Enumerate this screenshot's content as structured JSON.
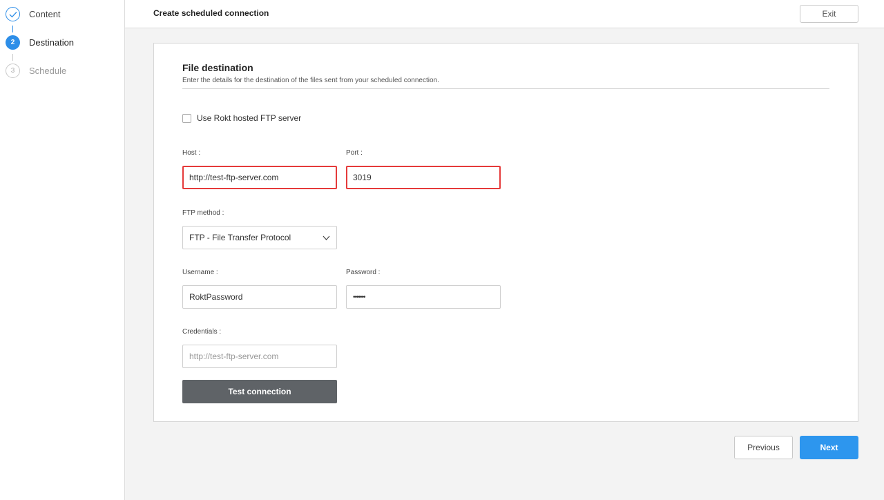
{
  "sidebar": {
    "steps": [
      {
        "label": "Content",
        "marker": "",
        "state": "completed",
        "icon": "check-icon"
      },
      {
        "label": "Destination",
        "marker": "2",
        "state": "active"
      },
      {
        "label": "Schedule",
        "marker": "3",
        "state": "upcoming"
      }
    ]
  },
  "header": {
    "title": "Create scheduled connection",
    "exit_label": "Exit"
  },
  "form": {
    "title": "File destination",
    "description": "Enter the details for the destination of the files sent from your scheduled connection.",
    "use_hosted_label": "Use Rokt hosted FTP server",
    "use_hosted_checked": false,
    "host": {
      "label": "Host",
      "value": "http://test-ftp-server.com",
      "error": true
    },
    "port": {
      "label": "Port",
      "value": "3019",
      "error": true
    },
    "ftp_method": {
      "label": "FTP method",
      "value": "FTP - File Transfer Protocol",
      "icon": "chevron-down-icon"
    },
    "username": {
      "label": "Username",
      "value": "RoktPassword"
    },
    "password": {
      "label": "Password",
      "value": "•••••••"
    },
    "credentials": {
      "label": "Credentials",
      "placeholder": "http://test-ftp-server.com"
    },
    "test_connection_label": "Test connection"
  },
  "footer": {
    "previous_label": "Previous",
    "next_label": "Next"
  },
  "colors": {
    "accent": "#2d96ee",
    "error": "#e53a3a",
    "button_dark": "#5f6367"
  }
}
